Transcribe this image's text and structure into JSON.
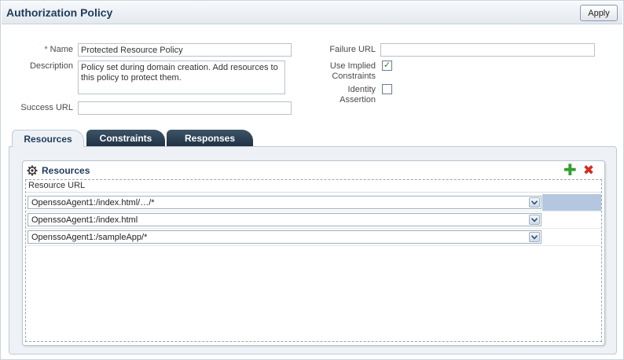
{
  "header": {
    "title": "Authorization Policy",
    "apply_label": "Apply"
  },
  "form": {
    "name": {
      "required_marker": "*",
      "label": "Name",
      "value": "Protected Resource Policy"
    },
    "description": {
      "label": "Description",
      "value": "Policy set during domain creation. Add resources to this policy to protect them."
    },
    "success_url": {
      "label": "Success URL",
      "value": ""
    },
    "failure_url": {
      "label": "Failure URL",
      "value": ""
    },
    "use_implied_constraints": {
      "label_line1": "Use Implied",
      "label_line2": "Constraints",
      "checked": true
    },
    "identity_assertion": {
      "label_line1": "Identity",
      "label_line2": "Assertion",
      "checked": false
    }
  },
  "tabs": [
    {
      "label": "Resources",
      "active": true
    },
    {
      "label": "Constraints",
      "active": false
    },
    {
      "label": "Responses",
      "active": false
    }
  ],
  "resources": {
    "title": "Resources",
    "icons": {
      "section": "gear-icon",
      "add": "add-icon",
      "delete": "delete-icon"
    },
    "column_header": "Resource URL",
    "rows": [
      {
        "value": "OpenssoAgent1:/index.html/…/*",
        "selected": true
      },
      {
        "value": "OpenssoAgent1:/index.html",
        "selected": false
      },
      {
        "value": "OpenssoAgent1:/sampleApp/*",
        "selected": false
      }
    ]
  },
  "colors": {
    "title": "#1f3b5c",
    "tab_inactive": "#2b3e52",
    "selected_row": "#b5c7df",
    "add_icon": "#33a02c",
    "delete_icon": "#d42a1f"
  }
}
